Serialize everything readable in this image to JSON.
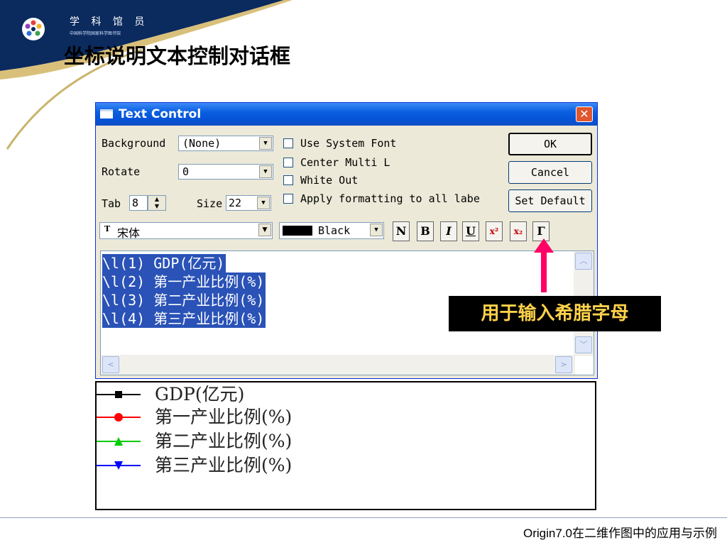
{
  "slide": {
    "org_name": "学 科 馆 员",
    "org_subtitle": "中国科学院国家科学图书馆",
    "title": "坐标说明文本控制对话框",
    "footer": "Origin7.0在二维作图中的应用与示例",
    "annotation": "用于输入希腊字母",
    "colors": {
      "banner": "#0b2a5e",
      "accent_arrow": "#ff0066",
      "callout_bg": "#000000",
      "callout_text": "#ffd24a"
    }
  },
  "dialog": {
    "title": "Text Control",
    "labels": {
      "background": "Background",
      "rotate": "Rotate",
      "tab": "Tab",
      "size": "Size"
    },
    "fields": {
      "background_value": "(None)",
      "rotate_value": "0",
      "tab_value": "8",
      "size_value": "22",
      "font_value": "宋体",
      "color_value": "Black"
    },
    "checkboxes": [
      {
        "label": "Use System Font",
        "checked": false
      },
      {
        "label": "Center Multi L",
        "checked": false
      },
      {
        "label": "White Out",
        "checked": false
      },
      {
        "label": "Apply formatting to all labe",
        "checked": false
      }
    ],
    "buttons": {
      "ok": "OK",
      "cancel": "Cancel",
      "set_default": "Set Default"
    },
    "format_buttons": [
      "N",
      "B",
      "I",
      "U",
      "x²",
      "x₂",
      "Γ"
    ],
    "editor_lines": [
      "\\l(1) GDP(亿元)",
      "\\l(2) 第一产业比例(%)",
      "\\l(3) 第二产业比例(%)",
      "\\l(4) 第三产业比例(%)"
    ]
  },
  "legend_preview": [
    {
      "text": "GDP(亿元)",
      "color": "#000000",
      "marker": "square"
    },
    {
      "text": "第一产业比例(%)",
      "color": "#ff0000",
      "marker": "circle"
    },
    {
      "text": "第二产业比例(%)",
      "color": "#00cc00",
      "marker": "triangle-up"
    },
    {
      "text": "第三产业比例(%)",
      "color": "#0000ff",
      "marker": "triangle-down"
    }
  ]
}
